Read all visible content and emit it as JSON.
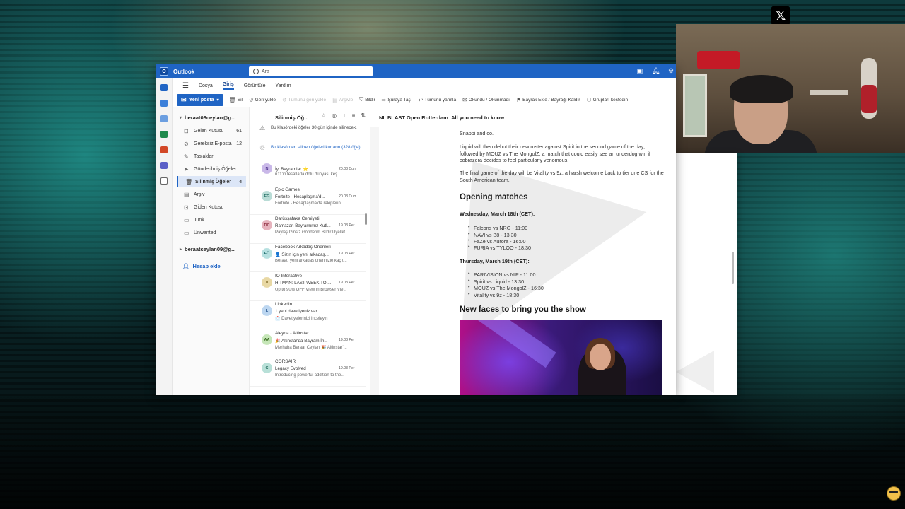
{
  "overlay": {
    "x_logo": "𝕏"
  },
  "app": {
    "title": "Outlook",
    "icon": "outlook-icon"
  },
  "search": {
    "placeholder": "Ara"
  },
  "menu": {
    "items": [
      "Dosya",
      "Giriş",
      "Görüntüle",
      "Yardım"
    ],
    "active": "Giriş"
  },
  "ribbon": {
    "new_mail": "Yeni posta",
    "buttons": [
      {
        "label": "Sil",
        "icon": "trash-icon",
        "enabled": true
      },
      {
        "label": "Geri yükle",
        "icon": "restore-icon",
        "enabled": true
      },
      {
        "label": "Tümünü geri yükle",
        "icon": "restore-all-icon",
        "enabled": false
      },
      {
        "label": "Arşivle",
        "icon": "archive-icon",
        "enabled": false
      },
      {
        "label": "Bildir",
        "icon": "shield-icon",
        "enabled": true
      },
      {
        "label": "Şuraya Taşı",
        "icon": "move-icon",
        "enabled": true
      },
      {
        "label": "Tümünü yanıtla",
        "icon": "reply-all-icon",
        "enabled": true
      },
      {
        "label": "Okundu / Okunmadı",
        "icon": "envelope-icon",
        "enabled": true
      },
      {
        "label": "Bayrak Ekle / Bayrağı Kaldır",
        "icon": "flag-icon",
        "enabled": true
      },
      {
        "label": "Grupları keşfedin",
        "icon": "groups-icon",
        "enabled": true
      }
    ]
  },
  "folders": {
    "account1": "beraat08ceylan@g...",
    "account2": "beraatceylan09@g...",
    "items": [
      {
        "label": "Gelen Kutusu",
        "count": "61",
        "icon": "inbox-icon"
      },
      {
        "label": "Gereksiz E-posta",
        "count": "12",
        "icon": "junk-icon"
      },
      {
        "label": "Taslaklar",
        "count": "",
        "icon": "draft-icon"
      },
      {
        "label": "Gönderilmiş Öğeler",
        "count": "",
        "icon": "send-icon"
      },
      {
        "label": "Silinmiş Öğeler",
        "count": "4",
        "icon": "trash-icon"
      },
      {
        "label": "Arşiv",
        "count": "",
        "icon": "archive-icon"
      },
      {
        "label": "Giden Kutusu",
        "count": "",
        "icon": "outbox-icon"
      },
      {
        "label": "Junk",
        "count": "",
        "icon": "folder-icon"
      },
      {
        "label": "Unwanted",
        "count": "",
        "icon": "folder-icon"
      }
    ],
    "add_account": "Hesap ekle"
  },
  "message_list": {
    "folder_title": "Silinmiş Öğ...",
    "notice1": "Bu klasördeki öğeler 30 gün içinde silinecek.",
    "notice2": "Bu klasörden silinen öğeleri kurtarın (328 öğe)",
    "messages": [
      {
        "initials": "N",
        "sender": "İyi Bayramlar ⭐",
        "subject": "n11'in fesatlarla dolu dünyası keşf...",
        "time": "20.03 Cum",
        "preview": "",
        "color": "#c9b8e8"
      },
      {
        "initials": "EG",
        "sender": "Epic Games",
        "subject": "Fortnite - Hesaplaşma'd...",
        "time": "20.03 Cum",
        "preview": "Fortnite - Hesaplaşma'da rakiplerini...",
        "color": "#b9dcd6"
      },
      {
        "initials": "DC",
        "sender": "Darüşşafaka Cemiyeti",
        "subject": "Ramazan Bayramımız Kutl...",
        "time": "19.03 Per",
        "preview": "Paylaş İzinsiz Gönderim Bildir Üyelikt...",
        "color": "#e6b3bd"
      },
      {
        "initials": "FÖ",
        "sender": "Facebook Arkadaş Önerileri",
        "subject": "👤 Sizin için yeni arkadaş...",
        "time": "19.03 Per",
        "preview": "Beraat, yeni arkadaş önerinizle kaç t...",
        "color": "#b6e0e0"
      },
      {
        "initials": "II",
        "sender": "IO Interactive",
        "subject": "HITMAN: LAST WEEK TO ...",
        "time": "19.03 Per",
        "preview": "Up to 90% OFF View in Browser Vie...",
        "color": "#e8d8a4"
      },
      {
        "initials": "L",
        "sender": "LinkedIn",
        "subject": "1 yeni davetiyeniz var",
        "time": "",
        "preview": "📩 Davetiyelerinizi inceleyin",
        "color": "#bcd6f0"
      },
      {
        "initials": "AA",
        "sender": "Aleyna - Altinstar",
        "subject": "🎉 Altinstar'da Bayram İn...",
        "time": "19.03 Per",
        "preview": "Merhaba Beraat Ceylan 🎉 Altinstar'...",
        "color": "#c6e6b8"
      },
      {
        "initials": "C",
        "sender": "CORSAIR",
        "subject": "Legacy Evolved",
        "time": "19.03 Per",
        "preview": "Introducing powerful addition to the...",
        "color": "#b8e0d8"
      }
    ]
  },
  "reading": {
    "subject": "NL BLAST Open Rotterdam: All you need to know",
    "para0": "Snappi and co.",
    "para1": "Liquid will then debut their new roster against Spirit in the second game of the day, followed by MOUZ vs The MongolZ, a match that could easily see an underdog win if cobrazera decides to feel particularly venomous.",
    "para2": "The final game of the day will be Vitality vs 9z, a harsh welcome back to tier one CS for the South American team.",
    "heading1": "Opening matches",
    "day1": "Wednesday, March 18th (CET):",
    "day1_matches": [
      "Falcons vs NRG - 11:00",
      "NAVI vs B8 - 13:30",
      "FaZe vs Aurora - 16:00",
      "FURIA vs TYLOO - 18:30"
    ],
    "day2": "Thursday, March 19th (CET):",
    "day2_matches": [
      "PARIVISION vs NIP - 11:00",
      "Spirit vs Liquid - 13:30",
      "MOUZ vs The MongolZ - 16:30",
      "Vitality vs 9z - 18:30"
    ],
    "heading2": "New faces to bring you the show"
  }
}
